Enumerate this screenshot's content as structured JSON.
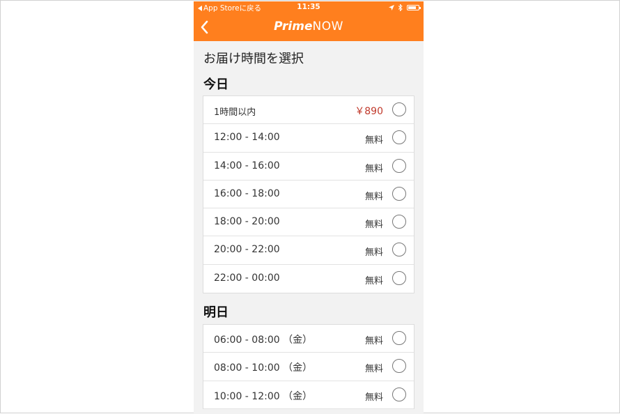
{
  "status_bar": {
    "back_label": "App Storeに戻る",
    "time": "11:35"
  },
  "header": {
    "brand_prime": "Prime",
    "brand_now": "NOW"
  },
  "page_title": "お届け時間を選択",
  "sections": {
    "today": {
      "title": "今日",
      "slots": [
        {
          "label": "1時間以内",
          "price": "￥890"
        },
        {
          "label": "12:00 - 14:00",
          "price": "無料"
        },
        {
          "label": "14:00 - 16:00",
          "price": "無料"
        },
        {
          "label": "16:00 - 18:00",
          "price": "無料"
        },
        {
          "label": "18:00 - 20:00",
          "price": "無料"
        },
        {
          "label": "20:00 - 22:00",
          "price": "無料"
        },
        {
          "label": "22:00 - 00:00",
          "price": "無料"
        }
      ]
    },
    "tomorrow": {
      "title": "明日",
      "slots": [
        {
          "label": "06:00 - 08:00 （金）",
          "price": "無料"
        },
        {
          "label": "08:00 - 10:00 （金）",
          "price": "無料"
        },
        {
          "label": "10:00 - 12:00 （金）",
          "price": "無料"
        }
      ]
    }
  },
  "colors": {
    "brand_orange": "#ff7f1e",
    "paid_price": "#c0392b",
    "background": "#f2f2f2"
  }
}
